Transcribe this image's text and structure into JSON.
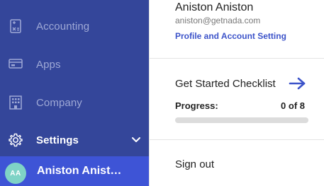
{
  "sidebar": {
    "items": [
      {
        "label": "Accounting",
        "icon": "calculator-icon"
      },
      {
        "label": "Apps",
        "icon": "apps-card-icon"
      },
      {
        "label": "Company",
        "icon": "building-icon"
      },
      {
        "label": "Settings",
        "icon": "gear-icon"
      }
    ],
    "user": {
      "initials": "AA",
      "name": "Aniston Anist…"
    }
  },
  "panel": {
    "name": "Aniston Aniston",
    "email": "aniston@getnada.com",
    "profile_link": "Profile and Account Setting",
    "checklist_label": "Get Started Checklist",
    "progress_label": "Progress:",
    "progress_count": "0 of 8",
    "progress_fraction": 0,
    "signout_label": "Sign out"
  },
  "colors": {
    "sidebar_bg": "#34469a",
    "active_user_bg": "#3e54d6",
    "accent": "#3c53c9",
    "avatar_bg": "#7fd3c6"
  }
}
